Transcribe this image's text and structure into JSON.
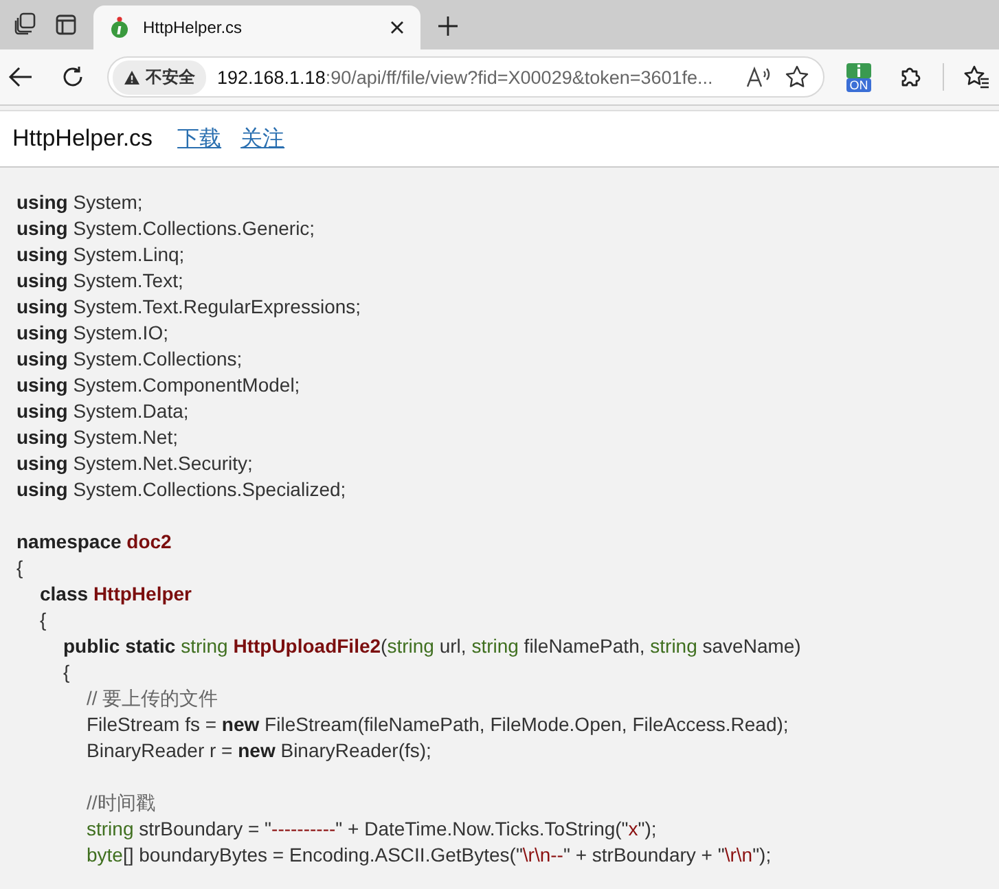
{
  "tab": {
    "title": "HttpHelper.cs",
    "selected": true
  },
  "address": {
    "security_label": "不安全",
    "host": "192.168.1.18",
    "path": ":90/api/ff/file/view?fid=X00029&token=3601fe..."
  },
  "extension": {
    "badge": "ON"
  },
  "header": {
    "title": "HttpHelper.cs",
    "links": [
      "下载",
      "关注"
    ]
  },
  "code": [
    {
      "tokens": [
        {
          "kind": "keyword",
          "text": "using"
        },
        {
          "kind": "plain",
          "text": " System;"
        }
      ]
    },
    {
      "tokens": [
        {
          "kind": "keyword",
          "text": "using"
        },
        {
          "kind": "plain",
          "text": " System.Collections.Generic;"
        }
      ]
    },
    {
      "tokens": [
        {
          "kind": "keyword",
          "text": "using"
        },
        {
          "kind": "plain",
          "text": " System.Linq;"
        }
      ]
    },
    {
      "tokens": [
        {
          "kind": "keyword",
          "text": "using"
        },
        {
          "kind": "plain",
          "text": " System.Text;"
        }
      ]
    },
    {
      "tokens": [
        {
          "kind": "keyword",
          "text": "using"
        },
        {
          "kind": "plain",
          "text": " System.Text.RegularExpressions;"
        }
      ]
    },
    {
      "tokens": [
        {
          "kind": "keyword",
          "text": "using"
        },
        {
          "kind": "plain",
          "text": " System.IO;"
        }
      ]
    },
    {
      "tokens": [
        {
          "kind": "keyword",
          "text": "using"
        },
        {
          "kind": "plain",
          "text": " System.Collections;"
        }
      ]
    },
    {
      "tokens": [
        {
          "kind": "keyword",
          "text": "using"
        },
        {
          "kind": "plain",
          "text": " System.ComponentModel;"
        }
      ]
    },
    {
      "tokens": [
        {
          "kind": "keyword",
          "text": "using"
        },
        {
          "kind": "plain",
          "text": " System.Data;"
        }
      ]
    },
    {
      "tokens": [
        {
          "kind": "keyword",
          "text": "using"
        },
        {
          "kind": "plain",
          "text": " System.Net;"
        }
      ]
    },
    {
      "tokens": [
        {
          "kind": "keyword",
          "text": "using"
        },
        {
          "kind": "plain",
          "text": " System.Net.Security;"
        }
      ]
    },
    {
      "tokens": [
        {
          "kind": "keyword",
          "text": "using"
        },
        {
          "kind": "plain",
          "text": " System.Collections.Specialized;"
        }
      ]
    },
    {
      "kind": "blank"
    },
    {
      "tokens": [
        {
          "kind": "keyword",
          "text": "namespace "
        },
        {
          "kind": "name",
          "text": "doc2"
        }
      ]
    },
    {
      "tokens": [
        {
          "kind": "plain",
          "text": "{"
        }
      ],
      "children": [
        {
          "tokens": [
            {
              "kind": "keyword",
              "text": "class "
            },
            {
              "kind": "name",
              "text": "HttpHelper"
            }
          ]
        },
        {
          "tokens": [
            {
              "kind": "plain",
              "text": "{"
            }
          ],
          "children": [
            {
              "tokens": [
                {
                  "kind": "keyword",
                  "text": "public static "
                },
                {
                  "kind": "type",
                  "text": "string"
                },
                {
                  "kind": "name",
                  "text": " HttpUploadFile2"
                },
                {
                  "kind": "plain",
                  "text": "("
                },
                {
                  "kind": "type",
                  "text": "string"
                },
                {
                  "kind": "plain",
                  "text": " url, "
                },
                {
                  "kind": "type",
                  "text": "string"
                },
                {
                  "kind": "plain",
                  "text": " fileNamePath, "
                },
                {
                  "kind": "type",
                  "text": "string"
                },
                {
                  "kind": "plain",
                  "text": " saveName)"
                }
              ]
            },
            {
              "tokens": [
                {
                  "kind": "plain",
                  "text": "{"
                }
              ],
              "children": [
                {
                  "tokens": [
                    {
                      "kind": "comment",
                      "text": "// 要上传的文件"
                    }
                  ]
                },
                {
                  "tokens": [
                    {
                      "kind": "plain",
                      "text": "FileStream fs = "
                    },
                    {
                      "kind": "keyword",
                      "text": "new"
                    },
                    {
                      "kind": "plain",
                      "text": " FileStream(fileNamePath, FileMode.Open, FileAccess.Read);"
                    }
                  ]
                },
                {
                  "tokens": [
                    {
                      "kind": "plain",
                      "text": "BinaryReader r = "
                    },
                    {
                      "kind": "keyword",
                      "text": "new"
                    },
                    {
                      "kind": "plain",
                      "text": " BinaryReader(fs);"
                    }
                  ]
                },
                {
                  "kind": "blank"
                },
                {
                  "tokens": [
                    {
                      "kind": "comment",
                      "text": "//时间戳"
                    }
                  ]
                },
                {
                  "tokens": [
                    {
                      "kind": "type",
                      "text": "string"
                    },
                    {
                      "kind": "plain",
                      "text": " strBoundary = \""
                    },
                    {
                      "kind": "string",
                      "text": "----------"
                    },
                    {
                      "kind": "plain",
                      "text": "\" + DateTime.Now.Ticks.ToString(\""
                    },
                    {
                      "kind": "string",
                      "text": "x"
                    },
                    {
                      "kind": "plain",
                      "text": "\");"
                    }
                  ]
                },
                {
                  "tokens": [
                    {
                      "kind": "type",
                      "text": "byte"
                    },
                    {
                      "kind": "plain",
                      "text": "[] boundaryBytes = Encoding.ASCII.GetBytes(\""
                    },
                    {
                      "kind": "string",
                      "text": "\\r\\n--"
                    },
                    {
                      "kind": "plain",
                      "text": "\" + strBoundary + \""
                    },
                    {
                      "kind": "string",
                      "text": "\\r\\n"
                    },
                    {
                      "kind": "plain",
                      "text": "\");"
                    }
                  ]
                }
              ]
            }
          ]
        }
      ]
    }
  ]
}
